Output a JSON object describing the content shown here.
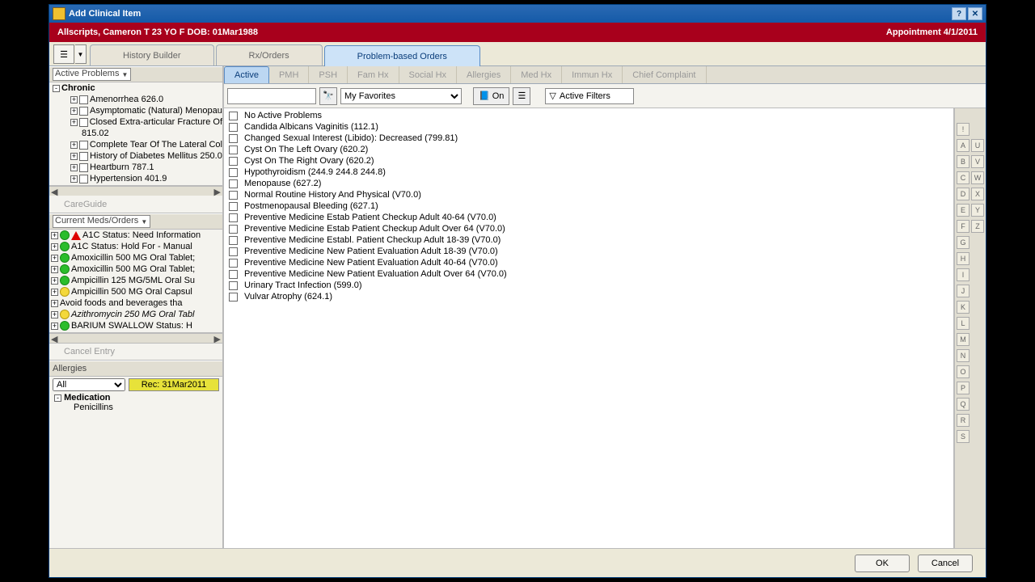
{
  "window": {
    "title": "Add Clinical Item"
  },
  "patient": {
    "info": "Allscripts, Cameron T  23 YO  F DOB: 01Mar1988",
    "appt": "Appointment  4/1/2011"
  },
  "tabs": {
    "history": "History Builder",
    "rx": "Rx/Orders",
    "pbo": "Problem-based Orders"
  },
  "subtabs": {
    "active": "Active",
    "pmh": "PMH",
    "psh": "PSH",
    "famhx": "Fam Hx",
    "socialhx": "Social Hx",
    "allergies": "Allergies",
    "medhx": "Med Hx",
    "immunhx": "Immun Hx",
    "chief": "Chief Complaint"
  },
  "toolbar": {
    "favs": "My Favorites",
    "on": "On",
    "filters": "Active Filters"
  },
  "sidebar": {
    "active_problems_label": "Active Problems",
    "chronic_label": "Chronic",
    "problems": [
      "Amenorrhea 626.0",
      "Asymptomatic (Natural) Menopau",
      "Closed Extra-articular Fracture Of",
      "815.02",
      "Complete Tear Of The Lateral Col",
      "History of  Diabetes Mellitus 250.0",
      "Heartburn 787.1",
      "Hypertension 401.9"
    ],
    "careguide": "CareGuide",
    "meds_label": "Current Meds/Orders",
    "meds": [
      {
        "t": "A1C  Status: Need Information",
        "i": "warn"
      },
      {
        "t": "A1C  Status: Hold For - Manual",
        "i": "green"
      },
      {
        "t": "Amoxicillin 500 MG Oral Tablet;",
        "i": "green"
      },
      {
        "t": "Amoxicillin 500 MG Oral Tablet;",
        "i": "green"
      },
      {
        "t": "Ampicillin 125 MG/5ML Oral Su",
        "i": "green"
      },
      {
        "t": "Ampicillin 500 MG Oral Capsul",
        "i": "yellow"
      },
      {
        "t": "Avoid foods and beverages tha",
        "i": "none"
      },
      {
        "t": "Azithromycin 250 MG Oral Tabl",
        "i": "yellow",
        "italic": true
      },
      {
        "t": "BARIUM SWALLOW  Status: H",
        "i": "green"
      }
    ],
    "cancel_entry": "Cancel Entry",
    "allergies_label": "Allergies",
    "allergy_filter": "All",
    "allergy_rec": "Rec: 31Mar2011",
    "allergy_cat": "Medication",
    "allergy_item": "Penicillins"
  },
  "problems": [
    "No Active Problems",
    "Candida Albicans Vaginitis (112.1)",
    "Changed Sexual Interest (Libido): Decreased (799.81)",
    "Cyst On The Left Ovary (620.2)",
    "Cyst On The Right Ovary (620.2)",
    "Hypothyroidism (244.9 244.8 244.8)",
    "Menopause (627.2)",
    "Normal Routine History And Physical (V70.0)",
    "Postmenopausal Bleeding (627.1)",
    "Preventive Medicine Estab Patient Checkup Adult 40-64 (V70.0)",
    "Preventive Medicine Estab Patient Checkup Adult Over 64 (V70.0)",
    "Preventive Medicine Establ. Patient Checkup Adult 18-39 (V70.0)",
    "Preventive Medicine New Patient Evaluation Adult 18-39 (V70.0)",
    "Preventive Medicine New Patient Evaluation Adult 40-64 (V70.0)",
    "Preventive Medicine New Patient Evaluation Adult Over 64 (V70.0)",
    "Urinary Tract Infection (599.0)",
    "Vulvar Atrophy (624.1)"
  ],
  "alpha": [
    [
      "!",
      ""
    ],
    [
      "A",
      "U"
    ],
    [
      "B",
      "V"
    ],
    [
      "C",
      "W"
    ],
    [
      "D",
      "X"
    ],
    [
      "E",
      "Y"
    ],
    [
      "F",
      "Z"
    ],
    [
      "G",
      ""
    ],
    [
      "H",
      ""
    ],
    [
      "I",
      ""
    ],
    [
      "J",
      ""
    ],
    [
      "K",
      ""
    ],
    [
      "L",
      ""
    ],
    [
      "M",
      ""
    ],
    [
      "N",
      ""
    ],
    [
      "O",
      ""
    ],
    [
      "P",
      ""
    ],
    [
      "Q",
      ""
    ],
    [
      "R",
      ""
    ],
    [
      "S",
      ""
    ]
  ],
  "footer": {
    "ok": "OK",
    "cancel": "Cancel"
  }
}
